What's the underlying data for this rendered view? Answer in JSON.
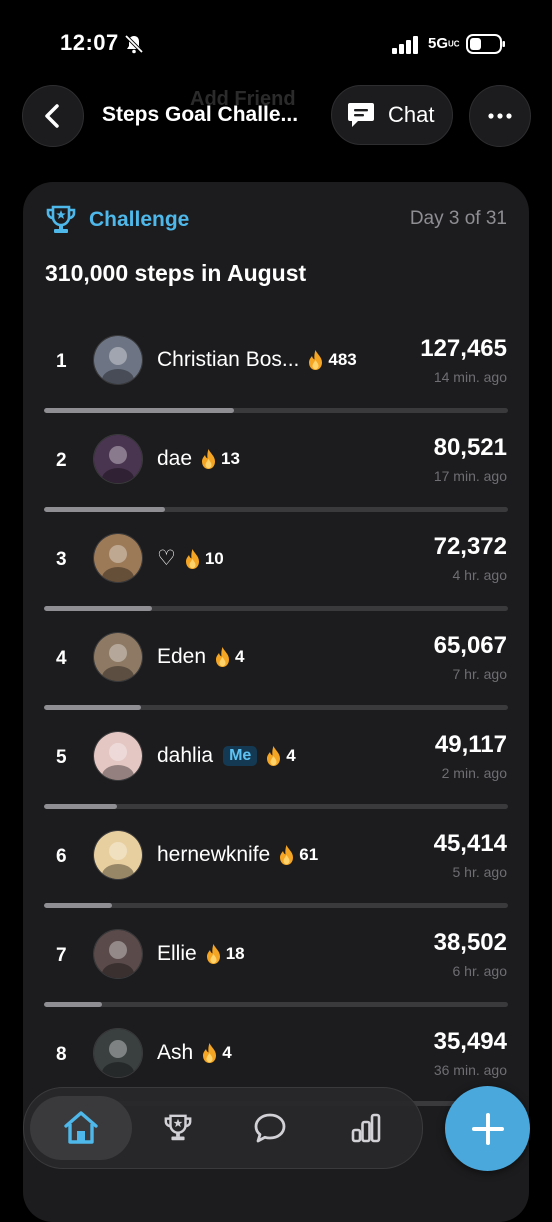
{
  "status": {
    "time": "12:07",
    "network": "5G",
    "network_suffix": "UC"
  },
  "background_hint": "Add Friend",
  "header": {
    "title": "Steps Goal Challe...",
    "chat_label": "Chat"
  },
  "challenge": {
    "label": "Challenge",
    "day": "Day 3 of 31",
    "goal": "310,000 steps in August"
  },
  "leaderboard": [
    {
      "rank": "1",
      "name": "Christian Bos...",
      "me": "",
      "streak": "483",
      "steps": "127,465",
      "ago": "14 min. ago",
      "progress": 0.41,
      "avatar_color": "#6d7584"
    },
    {
      "rank": "2",
      "name": "dae",
      "me": "",
      "streak": "13",
      "steps": "80,521",
      "ago": "17 min. ago",
      "progress": 0.26,
      "avatar_color": "#4a3550"
    },
    {
      "rank": "3",
      "name": "♡",
      "me": "",
      "streak": "10",
      "steps": "72,372",
      "ago": "4 hr. ago",
      "progress": 0.233,
      "avatar_color": "#9c7a58"
    },
    {
      "rank": "4",
      "name": "Eden",
      "me": "",
      "streak": "4",
      "steps": "65,067",
      "ago": "7 hr. ago",
      "progress": 0.21,
      "avatar_color": "#8e7a64"
    },
    {
      "rank": "5",
      "name": "dahlia",
      "me": "Me",
      "streak": "4",
      "steps": "49,117",
      "ago": "2 min. ago",
      "progress": 0.158,
      "avatar_color": "#e4c7c3"
    },
    {
      "rank": "6",
      "name": "hernewknife",
      "me": "",
      "streak": "61",
      "steps": "45,414",
      "ago": "5 hr. ago",
      "progress": 0.146,
      "avatar_color": "#e8cf9f"
    },
    {
      "rank": "7",
      "name": "Ellie",
      "me": "",
      "streak": "18",
      "steps": "38,502",
      "ago": "6 hr. ago",
      "progress": 0.124,
      "avatar_color": "#5a4a4a"
    },
    {
      "rank": "8",
      "name": "Ash",
      "me": "",
      "streak": "4",
      "steps": "35,494",
      "ago": "36 min. ago",
      "progress": 0.114,
      "avatar_color": "#3a4040"
    }
  ],
  "tabs": [
    "home",
    "challenges",
    "chat",
    "stats"
  ],
  "colors": {
    "accent": "#4fb8ea",
    "fab": "#4aa8dc",
    "card": "#1c1c1e",
    "flame": "#f5a524"
  }
}
